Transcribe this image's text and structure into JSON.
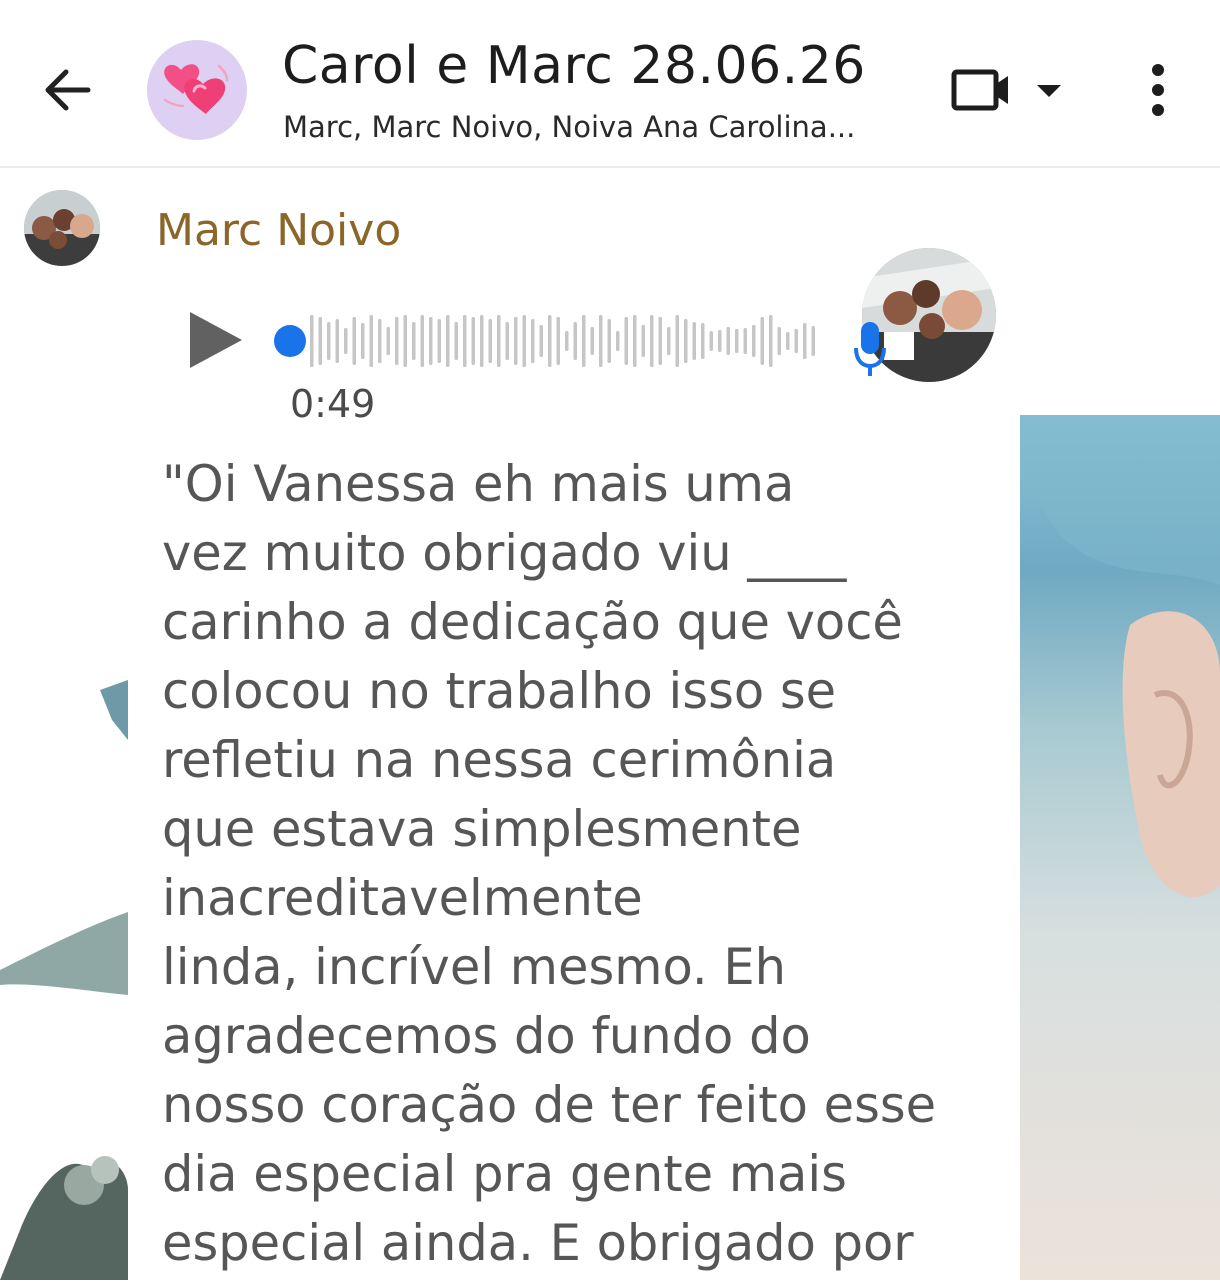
{
  "header": {
    "back_icon": "arrow-left-icon",
    "group_avatar_icon": "hearts-icon",
    "title": "Carol e Marc 28.06.26",
    "subtitle": "Marc, Marc Noivo, Noiva Ana Carolina...",
    "video_icon": "video-camera-icon",
    "dropdown_icon": "caret-down-icon",
    "more_icon": "more-vertical-icon"
  },
  "message": {
    "sender_name": "Marc Noivo",
    "voice": {
      "duration": "0:49",
      "progress": 0,
      "play_icon": "play-icon",
      "mic_icon": "microphone-icon"
    },
    "transcript": "\"Oi Vanessa eh mais uma\nvez muito obrigado viu ____\ncarinho a dedicação que você\ncolocou no trabalho isso se\nrefletiu na nessa cerimônia\nque estava simplesmente\ninacreditavelmente\nlinda, incrível mesmo. Eh\nagradecemos do fundo do\nnosso coração de ter feito esse\ndia especial pra gente mais\nespecial ainda. E obrigado por"
  },
  "colors": {
    "sender_name": "#8a6629",
    "text": "#565656",
    "playhead": "#1a73e8",
    "mic": "#1a73e8",
    "avatar_bg": "#ddd0f2"
  }
}
